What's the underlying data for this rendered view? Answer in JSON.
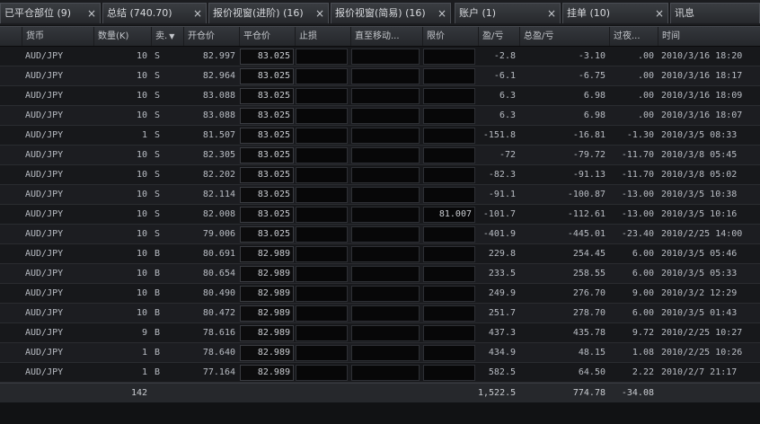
{
  "tabs": [
    {
      "label": "已平仓部位 (9)",
      "active": false
    },
    {
      "label": "总结 (740.70)",
      "active": false
    },
    {
      "label": "报价视窗(进阶) (16)",
      "active": false
    },
    {
      "label": "报价视窗(简易) (16)",
      "active": false
    },
    {
      "label": "账户 (1)",
      "active": false
    },
    {
      "label": "挂单 (10)",
      "active": false
    },
    {
      "label": "讯息",
      "active": false
    }
  ],
  "columns": {
    "currency": "货币",
    "amount": "数量(K)",
    "side": "卖.",
    "open": "开仓价",
    "close": "平仓价",
    "stop": "止损",
    "trailing": "直至移动...",
    "limit": "限价",
    "pl": "盈/亏",
    "gross_pl": "总盈/亏",
    "rollover": "过夜...",
    "time": "时间"
  },
  "rows": [
    {
      "currency": "AUD/JPY",
      "amount": "10",
      "side": "S",
      "open": "82.997",
      "close": "83.025",
      "stop": "",
      "trailing": "",
      "limit": "",
      "pl": "-2.8",
      "gross_pl": "-3.10",
      "rollover": ".00",
      "time": "2010/3/16 18:20"
    },
    {
      "currency": "AUD/JPY",
      "amount": "10",
      "side": "S",
      "open": "82.964",
      "close": "83.025",
      "stop": "",
      "trailing": "",
      "limit": "",
      "pl": "-6.1",
      "gross_pl": "-6.75",
      "rollover": ".00",
      "time": "2010/3/16 18:17"
    },
    {
      "currency": "AUD/JPY",
      "amount": "10",
      "side": "S",
      "open": "83.088",
      "close": "83.025",
      "stop": "",
      "trailing": "",
      "limit": "",
      "pl": "6.3",
      "gross_pl": "6.98",
      "rollover": ".00",
      "time": "2010/3/16 18:09"
    },
    {
      "currency": "AUD/JPY",
      "amount": "10",
      "side": "S",
      "open": "83.088",
      "close": "83.025",
      "stop": "",
      "trailing": "",
      "limit": "",
      "pl": "6.3",
      "gross_pl": "6.98",
      "rollover": ".00",
      "time": "2010/3/16 18:07"
    },
    {
      "currency": "AUD/JPY",
      "amount": "1",
      "side": "S",
      "open": "81.507",
      "close": "83.025",
      "stop": "",
      "trailing": "",
      "limit": "",
      "pl": "-151.8",
      "gross_pl": "-16.81",
      "rollover": "-1.30",
      "time": "2010/3/5 08:33"
    },
    {
      "currency": "AUD/JPY",
      "amount": "10",
      "side": "S",
      "open": "82.305",
      "close": "83.025",
      "stop": "",
      "trailing": "",
      "limit": "",
      "pl": "-72",
      "gross_pl": "-79.72",
      "rollover": "-11.70",
      "time": "2010/3/8 05:45"
    },
    {
      "currency": "AUD/JPY",
      "amount": "10",
      "side": "S",
      "open": "82.202",
      "close": "83.025",
      "stop": "",
      "trailing": "",
      "limit": "",
      "pl": "-82.3",
      "gross_pl": "-91.13",
      "rollover": "-11.70",
      "time": "2010/3/8 05:02"
    },
    {
      "currency": "AUD/JPY",
      "amount": "10",
      "side": "S",
      "open": "82.114",
      "close": "83.025",
      "stop": "",
      "trailing": "",
      "limit": "",
      "pl": "-91.1",
      "gross_pl": "-100.87",
      "rollover": "-13.00",
      "time": "2010/3/5 10:38"
    },
    {
      "currency": "AUD/JPY",
      "amount": "10",
      "side": "S",
      "open": "82.008",
      "close": "83.025",
      "stop": "",
      "trailing": "",
      "limit": "81.007",
      "pl": "-101.7",
      "gross_pl": "-112.61",
      "rollover": "-13.00",
      "time": "2010/3/5 10:16"
    },
    {
      "currency": "AUD/JPY",
      "amount": "10",
      "side": "S",
      "open": "79.006",
      "close": "83.025",
      "stop": "",
      "trailing": "",
      "limit": "",
      "pl": "-401.9",
      "gross_pl": "-445.01",
      "rollover": "-23.40",
      "time": "2010/2/25 14:00"
    },
    {
      "currency": "AUD/JPY",
      "amount": "10",
      "side": "B",
      "open": "80.691",
      "close": "82.989",
      "stop": "",
      "trailing": "",
      "limit": "",
      "pl": "229.8",
      "gross_pl": "254.45",
      "rollover": "6.00",
      "time": "2010/3/5 05:46"
    },
    {
      "currency": "AUD/JPY",
      "amount": "10",
      "side": "B",
      "open": "80.654",
      "close": "82.989",
      "stop": "",
      "trailing": "",
      "limit": "",
      "pl": "233.5",
      "gross_pl": "258.55",
      "rollover": "6.00",
      "time": "2010/3/5 05:33"
    },
    {
      "currency": "AUD/JPY",
      "amount": "10",
      "side": "B",
      "open": "80.490",
      "close": "82.989",
      "stop": "",
      "trailing": "",
      "limit": "",
      "pl": "249.9",
      "gross_pl": "276.70",
      "rollover": "9.00",
      "time": "2010/3/2 12:29"
    },
    {
      "currency": "AUD/JPY",
      "amount": "10",
      "side": "B",
      "open": "80.472",
      "close": "82.989",
      "stop": "",
      "trailing": "",
      "limit": "",
      "pl": "251.7",
      "gross_pl": "278.70",
      "rollover": "6.00",
      "time": "2010/3/5 01:43"
    },
    {
      "currency": "AUD/JPY",
      "amount": "9",
      "side": "B",
      "open": "78.616",
      "close": "82.989",
      "stop": "",
      "trailing": "",
      "limit": "",
      "pl": "437.3",
      "gross_pl": "435.78",
      "rollover": "9.72",
      "time": "2010/2/25 10:27"
    },
    {
      "currency": "AUD/JPY",
      "amount": "1",
      "side": "B",
      "open": "78.640",
      "close": "82.989",
      "stop": "",
      "trailing": "",
      "limit": "",
      "pl": "434.9",
      "gross_pl": "48.15",
      "rollover": "1.08",
      "time": "2010/2/25 10:26"
    },
    {
      "currency": "AUD/JPY",
      "amount": "1",
      "side": "B",
      "open": "77.164",
      "close": "82.989",
      "stop": "",
      "trailing": "",
      "limit": "",
      "pl": "582.5",
      "gross_pl": "64.50",
      "rollover": "2.22",
      "time": "2010/2/7 21:17"
    }
  ],
  "totals": {
    "amount": "142",
    "pl": "1,522.5",
    "gross_pl": "774.78",
    "rollover": "-34.08"
  },
  "icons": {
    "close": "close-icon",
    "sort": "sort-down-icon"
  }
}
